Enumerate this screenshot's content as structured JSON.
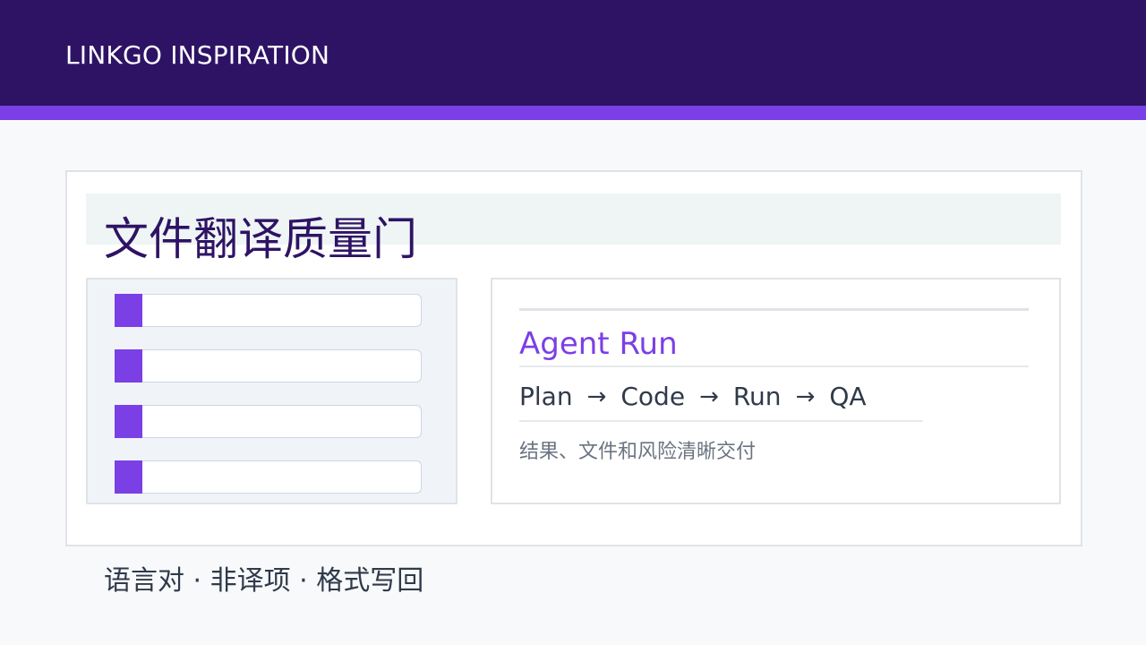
{
  "header": {
    "brand": "LINKGO INSPIRATION"
  },
  "slide": {
    "title": "文件翻译质量门",
    "list_rows": [
      "",
      "",
      "",
      ""
    ],
    "card": {
      "heading": "Agent Run",
      "flow": [
        "Plan",
        "Code",
        "Run",
        "QA"
      ],
      "arrow": "→",
      "note": "结果、文件和风险清晰交付"
    },
    "footer": "语言对 · 非译项 · 格式写回"
  },
  "colors": {
    "header_bg": "#2e1365",
    "accent": "#7b3fe6",
    "title_text": "#2e1365",
    "body_text": "#2f3a4a",
    "muted_text": "#6b7482"
  }
}
